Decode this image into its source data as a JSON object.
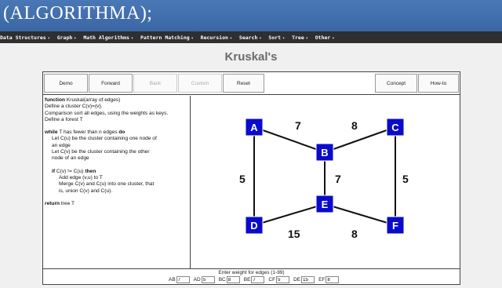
{
  "logo": "(ALGORITHMA);",
  "nav": [
    {
      "label": "Data Structures"
    },
    {
      "label": "Graph"
    },
    {
      "label": "Math Algorithms"
    },
    {
      "label": "Pattern Matching"
    },
    {
      "label": "Recursion"
    },
    {
      "label": "Search"
    },
    {
      "label": "Sort"
    },
    {
      "label": "Tree"
    },
    {
      "label": "Other"
    }
  ],
  "nav_caret": "▾",
  "title": "Kruskal's",
  "toolbar": {
    "demo": "Demo",
    "forward": "Forward",
    "back": "Back",
    "custom": "Custom",
    "reset": "Reset",
    "concept": "Concept",
    "howto": "How-to"
  },
  "code": {
    "l1_kw": "function",
    "l1": " Kruskal(array of edges)",
    "l2": "Define a cluster C(v)={v}.",
    "l3": "Comparison sort all edges, using the weights as keys.",
    "l4": "Define a forest T",
    "l5_kw": "while",
    "l5": " T has fewer than n edges ",
    "l5_kw2": "do",
    "l6": "Let C(u) be the cluster containing one node of",
    "l7": "an edge",
    "l8": "Let C(v) be the cluster containing the other",
    "l9": "node of an edge",
    "l10_kw": "if",
    "l10": " C(v) != C(u) ",
    "l10_kw2": "then",
    "l11": "Add edge (v,u) to T",
    "l12": "Merge C(v) and C(u) into one cluster, that",
    "l13": "is, union C(v) and C(u).",
    "l14_kw": "return",
    "l14": " tree T"
  },
  "graph": {
    "node_color": "#0a0acc",
    "nodes": [
      "A",
      "B",
      "C",
      "D",
      "E",
      "F"
    ],
    "edge_labels": {
      "AB": "7",
      "BC": "8",
      "BE": "7",
      "AD": "5",
      "CF": "5",
      "DE": "15",
      "EF": "8"
    }
  },
  "footer": {
    "label": "Enter weight for edges (1-99)",
    "edges": [
      {
        "name": "AB",
        "value": "7"
      },
      {
        "name": "AD",
        "value": "5"
      },
      {
        "name": "BC",
        "value": "8"
      },
      {
        "name": "BE",
        "value": "7"
      },
      {
        "name": "CF",
        "value": "5"
      },
      {
        "name": "DE",
        "value": "15"
      },
      {
        "name": "EF",
        "value": "8"
      }
    ]
  }
}
